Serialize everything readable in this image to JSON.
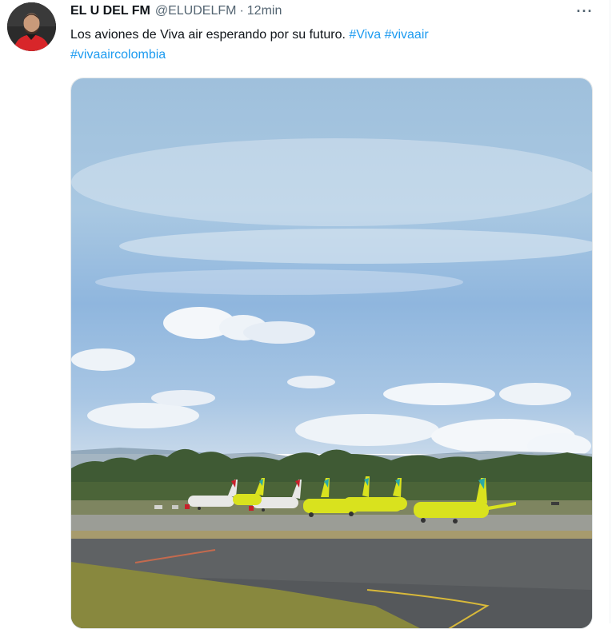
{
  "tweet": {
    "author_name": "EL U DEL FM",
    "author_handle": "@ELUDELFM",
    "separator": "·",
    "timestamp": "12min",
    "more_icon": "more-horizontal-icon",
    "more_label": "···",
    "text": "Los aviones de Viva air esperando por su futuro.",
    "hashtags": [
      "#Viva",
      "#vivaair",
      "#vivaaircolombia"
    ]
  },
  "colors": {
    "link": "#1d9bf0",
    "secondary_text": "#536471",
    "plane_livery": "#d9e21e"
  }
}
